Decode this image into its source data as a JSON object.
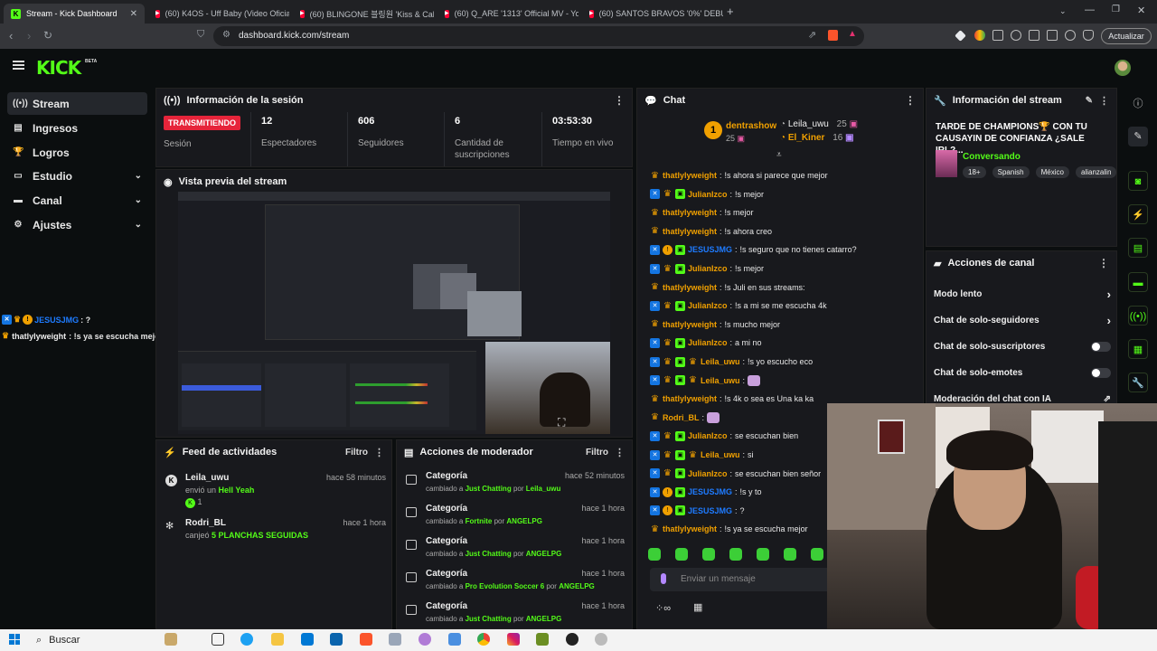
{
  "browser": {
    "tabs": [
      {
        "title": "Stream - Kick Dashboard",
        "active": true
      },
      {
        "title": "(60) K4OS - Uff Baby (Video Oficial)",
        "active": false
      },
      {
        "title": "(60) BLINGONE 블링원 'Kiss & Call'",
        "active": false
      },
      {
        "title": "(60) Q_ARE '1313' Official MV - You",
        "active": false
      },
      {
        "title": "(60) SANTOS BRAVOS '0%' DEBUT V",
        "active": false
      }
    ],
    "url": "dashboard.kick.com/stream",
    "update_label": "Actualizar"
  },
  "header": {
    "logo": "KICK",
    "beta": "BETA"
  },
  "sidebar": {
    "items": [
      {
        "label": "Stream",
        "icon": "stream-icon"
      },
      {
        "label": "Ingresos",
        "icon": "revenue-icon"
      },
      {
        "label": "Logros",
        "icon": "trophy-icon"
      },
      {
        "label": "Estudio",
        "icon": "studio-icon"
      },
      {
        "label": "Canal",
        "icon": "channel-icon"
      },
      {
        "label": "Ajustes",
        "icon": "settings-icon"
      }
    ]
  },
  "overlay_chat": [
    {
      "user": "JESUSJMG",
      "text": ": ?"
    },
    {
      "user": "thatlylyweight",
      "text": ": !s ya se escucha mejor"
    }
  ],
  "session": {
    "title": "Información de la sesión",
    "live_badge": "TRANSMITIENDO",
    "session_label": "Sesión",
    "stats": [
      {
        "value": "12",
        "label": "Espectadores"
      },
      {
        "value": "606",
        "label": "Seguidores"
      },
      {
        "value": "6",
        "label": "Cantidad de suscripciones"
      },
      {
        "value": "03:53:30",
        "label": "Tiempo en vivo"
      }
    ]
  },
  "preview": {
    "title": "Vista previa del stream"
  },
  "feed": {
    "title": "Feed de actividades",
    "filter": "Filtro",
    "items": [
      {
        "name": "Leila_uwu",
        "time": "hace 58 minutos",
        "pre": "envió un",
        "highlight": "Hell Yeah",
        "count": "1"
      },
      {
        "name": "Rodri_BL",
        "time": "hace 1 hora",
        "pre": "canjeó",
        "highlight": "5 PLANCHAS SEGUIDAS"
      }
    ]
  },
  "moderation": {
    "title": "Acciones de moderador",
    "filter": "Filtro",
    "items": [
      {
        "title": "Categoría",
        "time": "hace 52 minutos",
        "pre": "cambiado a",
        "category": "Just Chatting",
        "by": "por",
        "user": "Leila_uwu"
      },
      {
        "title": "Categoría",
        "time": "hace 1 hora",
        "pre": "cambiado a",
        "category": "Fortnite",
        "by": "por",
        "user": "ANGELPG"
      },
      {
        "title": "Categoría",
        "time": "hace 1 hora",
        "pre": "cambiado a",
        "category": "Just Chatting",
        "by": "por",
        "user": "ANGELPG"
      },
      {
        "title": "Categoría",
        "time": "hace 1 hora",
        "pre": "cambiado a",
        "category": "Pro Evolution Soccer 6",
        "by": "por",
        "user": "ANGELPG"
      },
      {
        "title": "Categoría",
        "time": "hace 1 hora",
        "pre": "cambiado a",
        "category": "Just Chatting",
        "by": "por",
        "user": "ANGELPG"
      }
    ]
  },
  "chat": {
    "title": "Chat",
    "pinned_rank": "1",
    "pinned": [
      {
        "user": "dentrashow",
        "count": "25"
      },
      {
        "user": "Leila_uwu",
        "count": "25"
      },
      {
        "user": "El_Kiner",
        "count": "16"
      }
    ],
    "messages": [
      {
        "user": "thatlylyweight",
        "text": "!s ahora si parece que mejor",
        "color": "#f0a000",
        "badges": [
          "crown"
        ]
      },
      {
        "user": "JulianIzco",
        "text": "!s mejor",
        "color": "#f0a000",
        "badges": [
          "vip",
          "crown",
          "sub"
        ]
      },
      {
        "user": "thatlylyweight",
        "text": "!s mejor",
        "color": "#f0a000",
        "badges": [
          "crown"
        ]
      },
      {
        "user": "thatlylyweight",
        "text": "!s ahora creo",
        "color": "#f0a000",
        "badges": [
          "crown"
        ]
      },
      {
        "user": "JESUSJMG",
        "text": "!s seguro que no tienes catarro?",
        "color": "#1e7bff",
        "badges": [
          "vip",
          "gift",
          "sub"
        ]
      },
      {
        "user": "JulianIzco",
        "text": "!s mejor",
        "color": "#f0a000",
        "badges": [
          "vip",
          "crown",
          "sub"
        ]
      },
      {
        "user": "thatlylyweight",
        "text": "!s Juli en sus streams:",
        "color": "#f0a000",
        "badges": [
          "crown"
        ]
      },
      {
        "user": "JulianIzco",
        "text": "!s a mi se me escucha 4k",
        "color": "#f0a000",
        "badges": [
          "vip",
          "crown",
          "sub"
        ]
      },
      {
        "user": "thatlylyweight",
        "text": "!s mucho mejor",
        "color": "#f0a000",
        "badges": [
          "crown"
        ]
      },
      {
        "user": "JulianIzco",
        "text": "a mi no",
        "color": "#f0a000",
        "badges": [
          "vip",
          "crown",
          "sub"
        ]
      },
      {
        "user": "Leila_uwu",
        "text": "!s yo escucho eco",
        "color": "#f0a000",
        "badges": [
          "vip",
          "crown",
          "sub",
          "crown"
        ]
      },
      {
        "user": "Leila_uwu",
        "text": "",
        "color": "#f0a000",
        "badges": [
          "vip",
          "crown",
          "sub",
          "crown"
        ],
        "emote": true
      },
      {
        "user": "thatlylyweight",
        "text": "!s 4k o sea es Una ka ka",
        "color": "#f0a000",
        "badges": [
          "crown"
        ]
      },
      {
        "user": "Rodri_BL",
        "text": "",
        "color": "#f0a000",
        "badges": [
          "crown"
        ],
        "emote": true
      },
      {
        "user": "JulianIzco",
        "text": "se escuchan bien",
        "color": "#f0a000",
        "badges": [
          "vip",
          "crown",
          "sub"
        ]
      },
      {
        "user": "Leila_uwu",
        "text": "si",
        "color": "#f0a000",
        "badges": [
          "vip",
          "crown",
          "sub",
          "crown"
        ]
      },
      {
        "user": "JulianIzco",
        "text": "se escuchan bien señor",
        "color": "#f0a000",
        "badges": [
          "vip",
          "crown",
          "sub"
        ]
      },
      {
        "user": "JESUSJMG",
        "text": "!s y to",
        "color": "#1e7bff",
        "badges": [
          "vip",
          "gift",
          "sub"
        ]
      },
      {
        "user": "JESUSJMG",
        "text": "?",
        "color": "#1e7bff",
        "badges": [
          "vip",
          "gift",
          "sub"
        ]
      },
      {
        "user": "thatlylyweight",
        "text": "!s ya se escucha mejor",
        "color": "#f0a000",
        "badges": [
          "crown"
        ]
      }
    ],
    "input_placeholder": "Enviar un mensaje"
  },
  "stream_info": {
    "title": "Información del stream",
    "stream_title": "TARDE DE CHAMPIONS🏆 CON TU CAUSAYIN DE CONFIANZA ¿SALE IRL?...",
    "category": "Conversando",
    "tags": [
      "18+",
      "Spanish",
      "México",
      "alianzalin"
    ]
  },
  "channel_actions": {
    "title": "Acciones de canal",
    "items": [
      {
        "label": "Modo lento",
        "control": "arrow"
      },
      {
        "label": "Chat de solo-seguidores",
        "control": "arrow"
      },
      {
        "label": "Chat de solo-suscriptores",
        "control": "toggle"
      },
      {
        "label": "Chat de solo-emotes",
        "control": "toggle"
      },
      {
        "label": "Moderación del chat con IA",
        "control": "external"
      }
    ]
  },
  "taskbar": {
    "search_label": "Buscar"
  },
  "colors": {
    "accent": "#53fc18",
    "live": "#e6243a",
    "panel": "#18191d",
    "bg": "#0b0e0f"
  }
}
